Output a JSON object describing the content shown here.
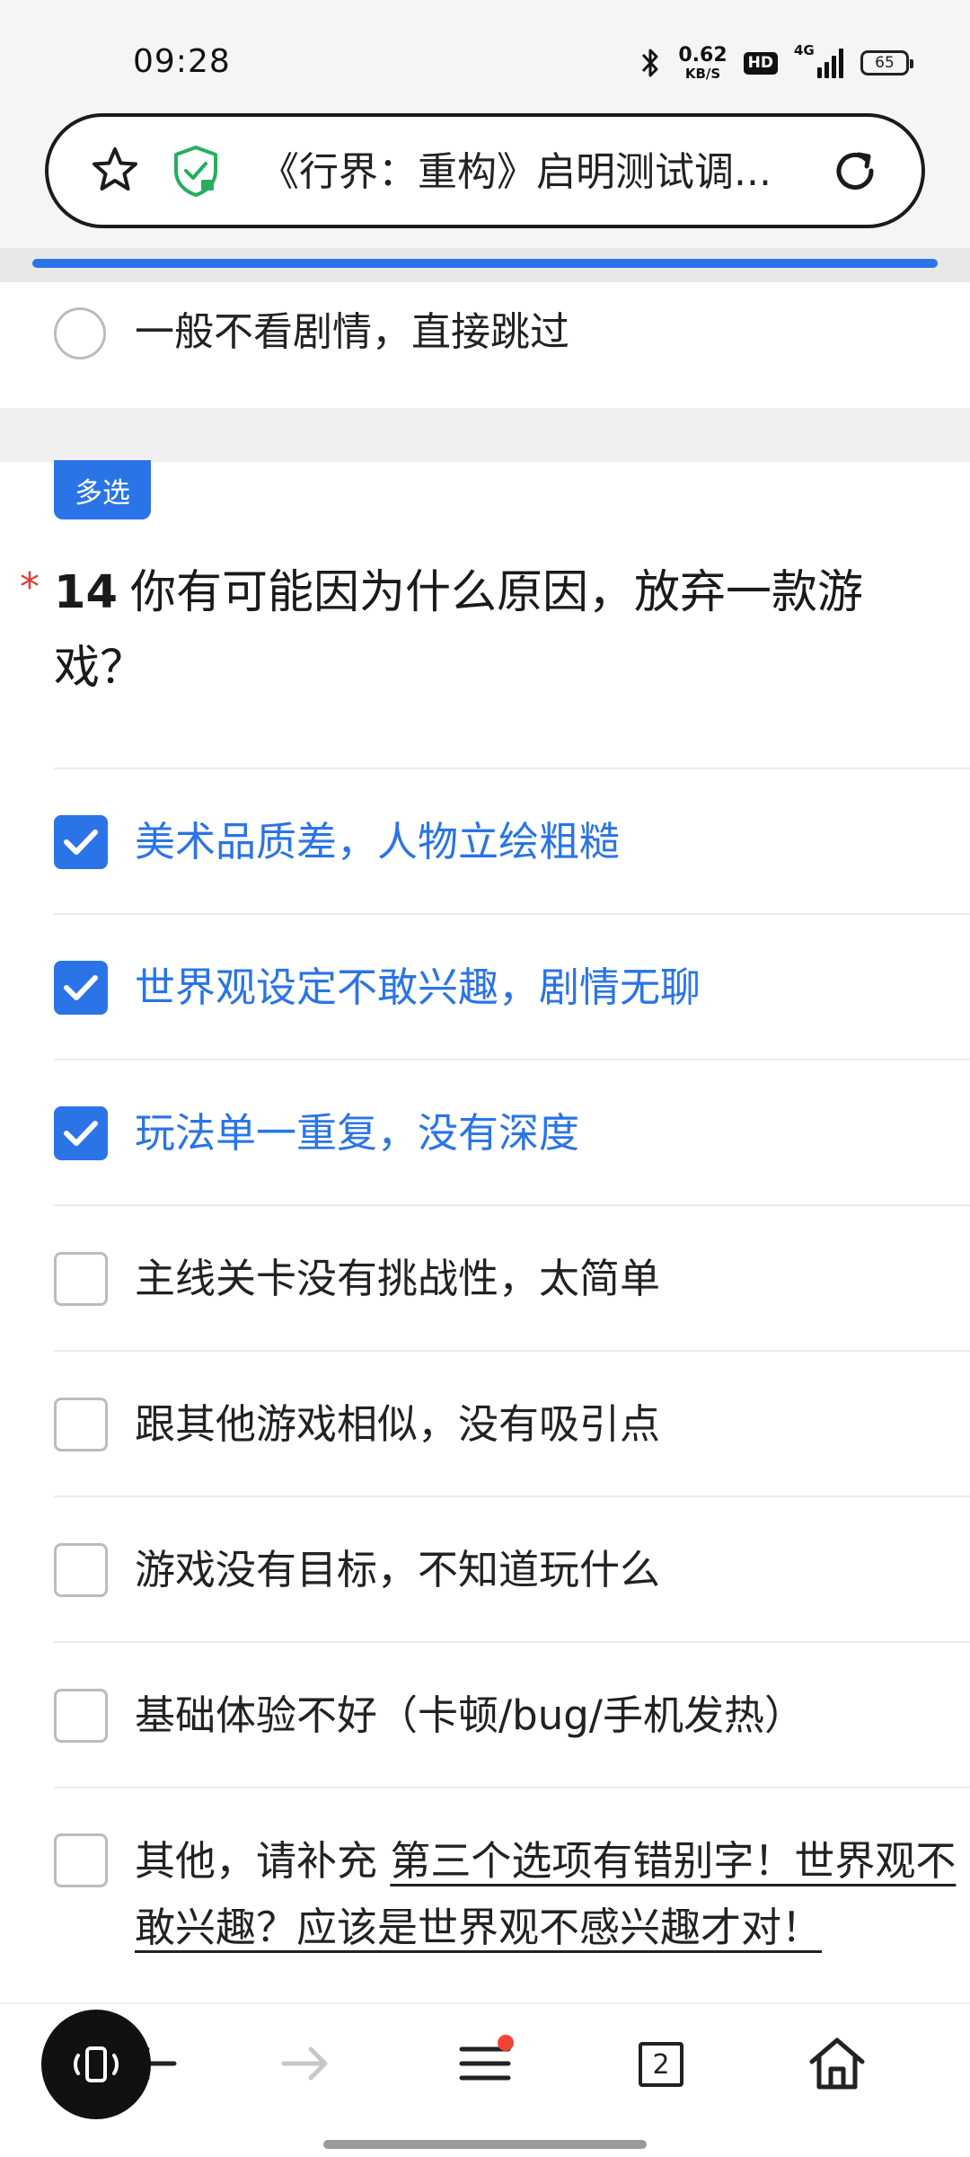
{
  "status_bar": {
    "time": "09:28",
    "net_speed_value": "0.62",
    "net_speed_unit": "KB/S",
    "hd_label": "HD",
    "signal_label": "4G",
    "battery_level": "65"
  },
  "browser": {
    "page_title": "《行界：重构》启明测试调...",
    "load_progress_percent": 100
  },
  "prev_question": {
    "last_option": "一般不看剧情，直接跳过"
  },
  "question": {
    "type_tag": "多选",
    "required_mark": "*",
    "number": "14",
    "title": "你有可能因为什么原因，放弃一款游戏？",
    "options": [
      {
        "label": "美术品质差，人物立绘粗糙",
        "checked": true
      },
      {
        "label": "世界观设定不敢兴趣，剧情无聊",
        "checked": true
      },
      {
        "label": "玩法单一重复，没有深度",
        "checked": true
      },
      {
        "label": "主线关卡没有挑战性，太简单",
        "checked": false
      },
      {
        "label": "跟其他游戏相似，没有吸引点",
        "checked": false
      },
      {
        "label": "游戏没有目标，不知道玩什么",
        "checked": false
      },
      {
        "label": "基础体验不好（卡顿/bug/手机发热）",
        "checked": false
      }
    ],
    "other": {
      "label": "其他，请补充",
      "value": "第三个选项有错别字！世界观不敢兴趣？应该是世界观不感兴趣才对！",
      "checked": false
    }
  },
  "bottom_nav": {
    "tab_count": "2"
  },
  "colors": {
    "accent": "#2a74e8",
    "required": "#e53935",
    "security_green": "#27ae60"
  }
}
